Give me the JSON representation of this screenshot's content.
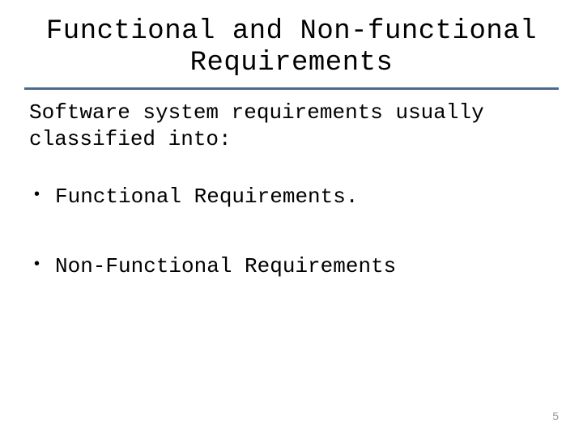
{
  "title": "Functional and Non-functional Requirements",
  "intro": "Software system requirements usually classified into:",
  "bullets": [
    "Functional Requirements.",
    "Non-Functional Requirements"
  ],
  "page_number": "5"
}
